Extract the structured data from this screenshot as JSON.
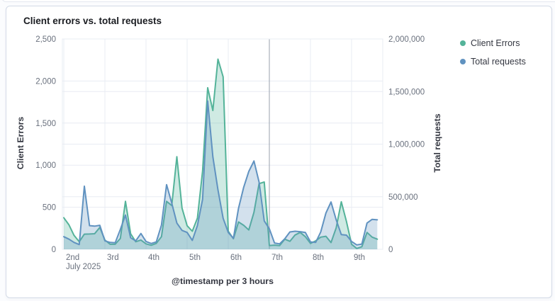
{
  "card": {
    "title": "Client errors vs. total requests"
  },
  "legend": {
    "items": [
      {
        "label": "Client Errors",
        "color": "#54b399"
      },
      {
        "label": "Total requests",
        "color": "#6092c0"
      }
    ]
  },
  "chart_data": {
    "type": "area",
    "title": "Client errors vs. total requests",
    "grid_color": "#e8ecf3",
    "grid_emphasis_color": "#98a1ae",
    "legend_position": "right",
    "x_axis": {
      "title": "@timestamp per 3 hours",
      "interval_hours": 3,
      "start": "July 2 2025 00:00",
      "day_ticks": [
        {
          "label": "2nd",
          "sublabel": "July 2025",
          "index": 0
        },
        {
          "label": "3rd",
          "index": 8
        },
        {
          "label": "4th",
          "index": 16
        },
        {
          "label": "5th",
          "index": 24
        },
        {
          "label": "6th",
          "index": 32
        },
        {
          "label": "7th",
          "index": 40,
          "week_start": true
        },
        {
          "label": "8th",
          "index": 48
        },
        {
          "label": "9th",
          "index": 56
        }
      ]
    },
    "left_axis": {
      "title": "Client Errors",
      "min": 0,
      "max": 2500,
      "ticks": [
        {
          "value": 0,
          "label": "0"
        },
        {
          "value": 500,
          "label": "500"
        },
        {
          "value": 1000,
          "label": "1,000"
        },
        {
          "value": 1500,
          "label": "1,500"
        },
        {
          "value": 2000,
          "label": "2,000"
        },
        {
          "value": 2500,
          "label": "2,500"
        }
      ]
    },
    "right_axis": {
      "title": "Total requests",
      "min": 0,
      "max": 2000000,
      "ticks": [
        {
          "value": 0,
          "label": "0"
        },
        {
          "value": 500000,
          "label": "500,000"
        },
        {
          "value": 1000000,
          "label": "1,000,000"
        },
        {
          "value": 1500000,
          "label": "1,500,000"
        },
        {
          "value": 2000000,
          "label": "2,000,000"
        }
      ]
    },
    "series": [
      {
        "name": "Client Errors",
        "axis": "left",
        "color": "#54b399",
        "fill": "rgba(84,179,153,0.28)",
        "values": [
          375,
          290,
          165,
          90,
          180,
          182,
          185,
          260,
          110,
          60,
          60,
          130,
          570,
          185,
          90,
          110,
          65,
          48,
          70,
          150,
          570,
          520,
          1100,
          490,
          280,
          215,
          370,
          930,
          1920,
          1650,
          2260,
          2050,
          215,
          125,
          325,
          285,
          230,
          440,
          780,
          800,
          45,
          50,
          45,
          120,
          95,
          170,
          200,
          150,
          70,
          100,
          145,
          155,
          80,
          255,
          565,
          330,
          60,
          10,
          30,
          200,
          145,
          120
        ]
      },
      {
        "name": "Total requests",
        "axis": "right",
        "color": "#6092c0",
        "fill": "rgba(96,146,192,0.28)",
        "values": [
          120000,
          96000,
          65000,
          45000,
          600000,
          225000,
          220000,
          228000,
          80000,
          65000,
          62000,
          190000,
          325000,
          110000,
          80000,
          150000,
          75000,
          55000,
          70000,
          230000,
          615000,
          440000,
          250000,
          180000,
          160000,
          85000,
          225000,
          475000,
          1410000,
          880000,
          565000,
          295000,
          160000,
          105000,
          390000,
          590000,
          740000,
          840000,
          640000,
          270000,
          195000,
          60000,
          52000,
          100000,
          165000,
          172000,
          168000,
          160000,
          70000,
          65000,
          165000,
          345000,
          450000,
          280000,
          140000,
          135000,
          75000,
          42000,
          50000,
          250000,
          285000,
          280000
        ]
      }
    ]
  }
}
